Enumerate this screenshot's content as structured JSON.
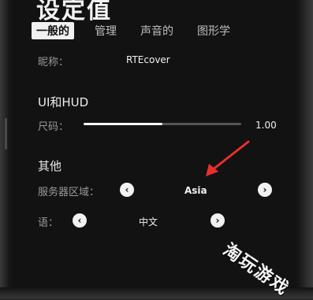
{
  "page": {
    "title": "设定值"
  },
  "tabs": [
    {
      "label": "一般的",
      "active": true
    },
    {
      "label": "管理",
      "active": false
    },
    {
      "label": "声音的",
      "active": false
    },
    {
      "label": "图形学",
      "active": false
    }
  ],
  "nickname": {
    "label": "昵称：",
    "value": "RTEcover"
  },
  "ui_hud": {
    "heading": "UI和HUD",
    "size_label": "尺码：",
    "size_value_text": "1.00",
    "slider_level_percent": 50
  },
  "other": {
    "heading": "其他",
    "region_label": "服务器区域：",
    "region_value": "Asia",
    "language_label": "语：",
    "language_value": "中文"
  },
  "icons": {
    "prev": "‹",
    "next": "›"
  },
  "watermark": {
    "text": "淘玩游戏"
  },
  "colors": {
    "background": "#121212",
    "accent_arrow": "#e8302c",
    "active_tab_bg": "#f0f0f0"
  }
}
